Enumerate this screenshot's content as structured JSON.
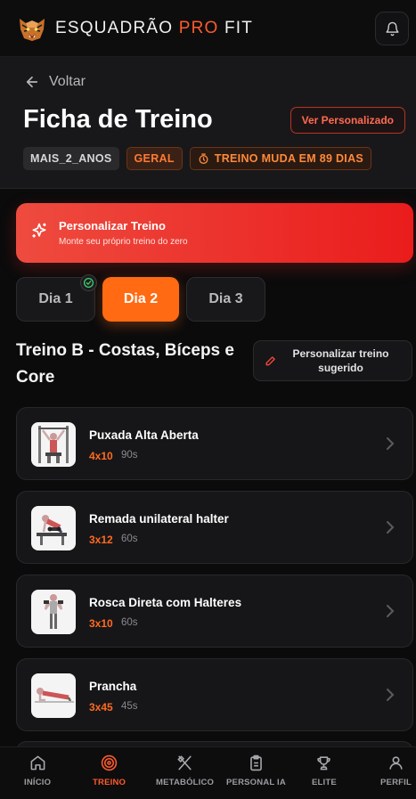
{
  "app": {
    "brand_main": "ESQUADRÃO ",
    "brand_accent": "PRO",
    "brand_tail": " FIT"
  },
  "header": {
    "back_label": "Voltar",
    "title": "Ficha de Treino",
    "ver_personalizado_label": "Ver Personalizado",
    "badges": [
      "MAIS_2_ANOS",
      "GERAL",
      "TREINO MUDA EM 89 DIAS"
    ]
  },
  "banner": {
    "title": "Personalizar Treino",
    "subtitle": "Monte seu próprio treino do zero"
  },
  "days": [
    {
      "label": "Dia 1",
      "completed": true
    },
    {
      "label": "Dia 2",
      "active": true
    },
    {
      "label": "Dia 3"
    }
  ],
  "workout": {
    "title": "Treino B - Costas, Bíceps e Core",
    "customize_label": "Personalizar treino sugerido"
  },
  "exercises": [
    {
      "name": "Puxada Alta Aberta",
      "sets": "4x10",
      "rest": "90s"
    },
    {
      "name": "Remada unilateral halter",
      "sets": "3x12",
      "rest": "60s"
    },
    {
      "name": "Rosca Direta com Halteres",
      "sets": "3x10",
      "rest": "60s"
    },
    {
      "name": "Prancha",
      "sets": "3x45",
      "rest": "45s"
    }
  ],
  "nav": [
    {
      "label": "INÍCIO",
      "icon": "home-icon"
    },
    {
      "label": "TREINO",
      "icon": "target-icon",
      "active": true
    },
    {
      "label": "METABÓLICO",
      "icon": "utensils-icon"
    },
    {
      "label": "PERSONAL IA",
      "icon": "clipboard-icon"
    },
    {
      "label": "ELITE",
      "icon": "trophy-icon"
    },
    {
      "label": "PERFIL",
      "icon": "user-icon"
    }
  ],
  "colors": {
    "accent": "#ff6a12",
    "danger": "#ea1c1c",
    "background": "#0b0b0c"
  }
}
